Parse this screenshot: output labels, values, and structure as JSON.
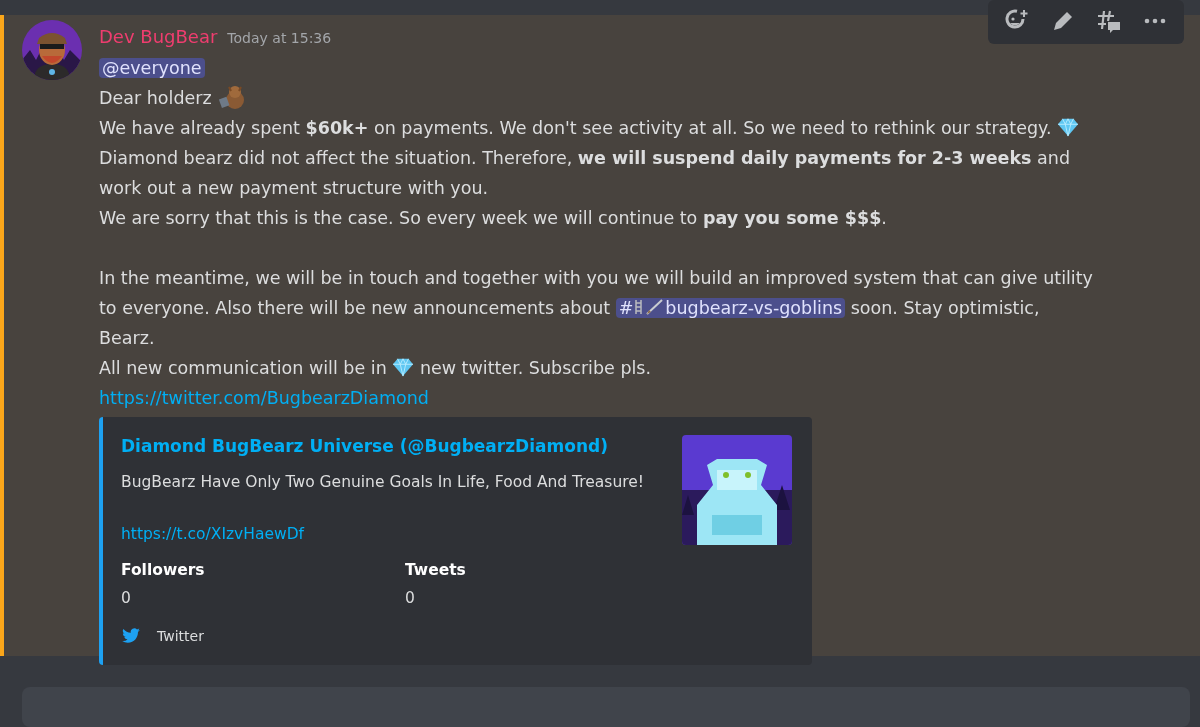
{
  "message": {
    "author": "Dev BugBear",
    "timestamp": "Today at 15:36",
    "mention": "@everyone",
    "lines": [
      {
        "kind": "text",
        "parts": [
          {
            "kind": "text",
            "text": "Dear holderz "
          },
          {
            "kind": "bear"
          }
        ]
      },
      {
        "kind": "text",
        "parts": [
          {
            "kind": "text",
            "text": "We have already spent **$60k+** on payments. We don't see activity at all. So we need to rethink our strategy. "
          },
          {
            "kind": "diamond"
          },
          {
            "kind": "text",
            "text": " Diamond bearz did not affect the situation. Therefore, **we will suspend daily payments for 2-3 weeks** and work out a new payment structure with you."
          }
        ]
      },
      {
        "kind": "text",
        "parts": [
          {
            "kind": "text",
            "text": "We are sorry that this is the case. So every week we will continue to **pay you some $$$**."
          }
        ]
      },
      {
        "kind": "blank"
      },
      {
        "kind": "text",
        "parts": [
          {
            "kind": "text",
            "text": "In the meantime, we will be in touch and together with you we will build an improved system that can give utility to everyone. Also there will be new announcements about "
          },
          {
            "kind": "channel",
            "prefix": "#",
            "text": "bugbearz-vs-goblins"
          },
          {
            "kind": "text",
            "text": " soon. Stay optimistic, Bearz."
          }
        ]
      },
      {
        "kind": "text",
        "parts": [
          {
            "kind": "text",
            "text": "All new communication will be in "
          },
          {
            "kind": "diamond"
          },
          {
            "kind": "text",
            "text": " new twitter. Subscribe pls."
          }
        ]
      }
    ],
    "link": "https://twitter.com/BugbearzDiamond",
    "embed": {
      "title": "Diamond BugBearz Universe (@BugbearzDiamond)",
      "description": "BugBearz Have Only Two Genuine Goals In Life, Food And Treasure!",
      "link": "https://t.co/XIzvHaewDf",
      "fields": [
        {
          "name": "Followers",
          "value": "0"
        },
        {
          "name": "Tweets",
          "value": "0"
        }
      ],
      "footer": "Twitter"
    }
  },
  "toolbar": [
    {
      "kind": "reaction"
    },
    {
      "kind": "edit"
    },
    {
      "kind": "thread"
    },
    {
      "kind": "more"
    }
  ]
}
